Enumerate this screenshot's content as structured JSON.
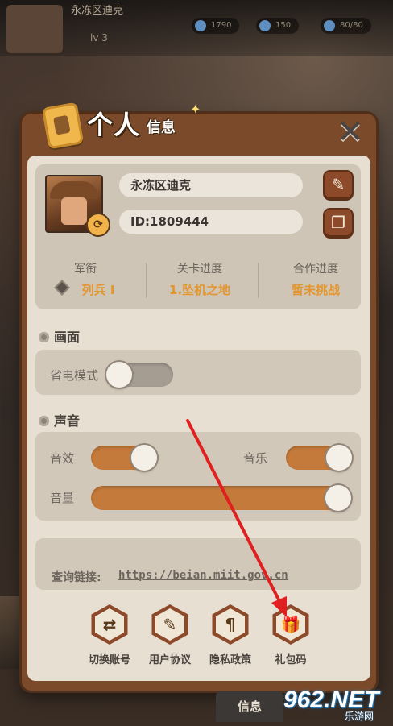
{
  "hud": {
    "player_name": "永冻区迪克",
    "level": "lv 3",
    "resources": [
      "1790",
      "150",
      "80/80"
    ]
  },
  "panel": {
    "title_main": "个人",
    "title_sub": "信息",
    "close_label": "✕"
  },
  "profile": {
    "name": "永冻区迪克",
    "id": "ID:1809444",
    "stats": [
      {
        "label": "军衔",
        "value": "列兵 I"
      },
      {
        "label": "关卡进度",
        "value": "1.坠机之地"
      },
      {
        "label": "合作进度",
        "value": "暂未挑战"
      }
    ],
    "edit_icon": "pencil-icon",
    "copy_icon": "copy-icon"
  },
  "display": {
    "header": "画面",
    "power_saving_label": "省电模式",
    "power_saving_on": false
  },
  "sound": {
    "header": "声音",
    "sfx_label": "音效",
    "sfx_on": true,
    "music_label": "音乐",
    "music_on": true,
    "volume_label": "音量",
    "volume_level": 1.0
  },
  "links": {
    "label": "查询链接:",
    "url": "https://beian.miit.gov.cn"
  },
  "actions": [
    {
      "label": "切换账号",
      "icon": "switch-icon"
    },
    {
      "label": "用户协议",
      "icon": "document-icon"
    },
    {
      "label": "隐私政策",
      "icon": "scroll-icon"
    },
    {
      "label": "礼包码",
      "icon": "gift-icon"
    }
  ],
  "bottom_tab": {
    "label": "信息"
  },
  "watermark": {
    "big": "962.NET",
    "small": "乐游网"
  },
  "colors": {
    "panel_frame": "#7a4a2a",
    "panel_bg": "#e7dfd2",
    "accent_orange": "#e3962f",
    "toggle_on": "#c47a3a",
    "arrow": "#e02020"
  }
}
